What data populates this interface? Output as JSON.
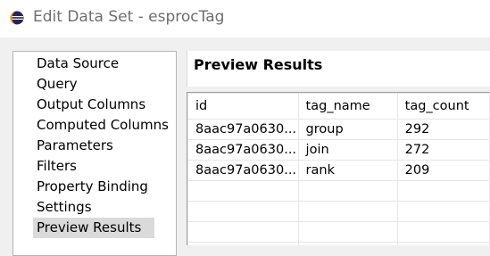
{
  "window": {
    "title": "Edit Data Set - esprocTag",
    "icon": "eclipse-icon"
  },
  "nav": {
    "items": [
      {
        "label": "Data Source",
        "selected": false
      },
      {
        "label": "Query",
        "selected": false
      },
      {
        "label": "Output Columns",
        "selected": false
      },
      {
        "label": "Computed Columns",
        "selected": false
      },
      {
        "label": "Parameters",
        "selected": false
      },
      {
        "label": "Filters",
        "selected": false
      },
      {
        "label": "Property Binding",
        "selected": false
      },
      {
        "label": "Settings",
        "selected": false
      },
      {
        "label": "Preview Results",
        "selected": true
      }
    ]
  },
  "preview": {
    "title": "Preview Results",
    "columns": [
      "id",
      "tag_name",
      "tag_count"
    ],
    "rows": [
      [
        "8aac97a0630...",
        "group",
        "292"
      ],
      [
        "8aac97a0630...",
        "join",
        "272"
      ],
      [
        "8aac97a0630...",
        "rank",
        "209"
      ]
    ]
  },
  "colors": {
    "selection": "#dadada",
    "panel_border": "#b4b4b4",
    "dialog_background": "#f0f0f0"
  }
}
